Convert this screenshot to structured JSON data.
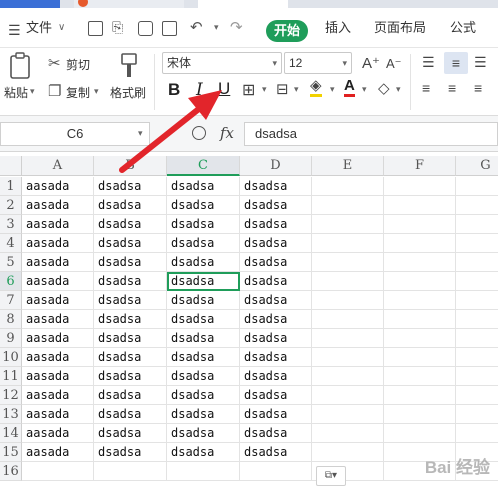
{
  "menubar": {
    "file_label": "文件",
    "start_label": "开始",
    "insert_label": "插入",
    "layout_label": "页面布局",
    "formula_label": "公式"
  },
  "ribbon": {
    "paste_label": "粘贴",
    "cut_label": "剪切",
    "copy_label": "复制",
    "format_painter_label": "格式刷",
    "font_name": "宋体",
    "font_size": "12",
    "bold": "B",
    "italic": "I",
    "underline": "U",
    "font_color": "#e02020",
    "accent": "#1f9d5a"
  },
  "formula_bar": {
    "cell_ref": "C6",
    "fx": "fx",
    "value": "dsadsa"
  },
  "sheet": {
    "columns": [
      "A",
      "B",
      "C",
      "D",
      "E",
      "F",
      "G"
    ],
    "rows": [
      "1",
      "2",
      "3",
      "4",
      "5",
      "6",
      "7",
      "8",
      "9",
      "10",
      "11",
      "12",
      "13",
      "14",
      "15",
      "16"
    ],
    "data": [
      [
        "aasada",
        "dsadsa",
        "dsadsa",
        "dsadsa"
      ],
      [
        "aasada",
        "dsadsa",
        "dsadsa",
        "dsadsa"
      ],
      [
        "aasada",
        "dsadsa",
        "dsadsa",
        "dsadsa"
      ],
      [
        "aasada",
        "dsadsa",
        "dsadsa",
        "dsadsa"
      ],
      [
        "aasada",
        "dsadsa",
        "dsadsa",
        "dsadsa"
      ],
      [
        "aasada",
        "dsadsa",
        "dsadsa",
        "dsadsa"
      ],
      [
        "aasada",
        "dsadsa",
        "dsadsa",
        "dsadsa"
      ],
      [
        "aasada",
        "dsadsa",
        "dsadsa",
        "dsadsa"
      ],
      [
        "aasada",
        "dsadsa",
        "dsadsa",
        "dsadsa"
      ],
      [
        "aasada",
        "dsadsa",
        "dsadsa",
        "dsadsa"
      ],
      [
        "aasada",
        "dsadsa",
        "dsadsa",
        "dsadsa"
      ],
      [
        "aasada",
        "dsadsa",
        "dsadsa",
        "dsadsa"
      ],
      [
        "aasada",
        "dsadsa",
        "dsadsa",
        "dsadsa"
      ],
      [
        "aasada",
        "dsadsa",
        "dsadsa",
        "dsadsa"
      ],
      [
        "aasada",
        "dsadsa",
        "dsadsa",
        "dsadsa"
      ]
    ],
    "selected_row": 6,
    "selected_col": "C"
  },
  "watermark": "Bai 经验"
}
